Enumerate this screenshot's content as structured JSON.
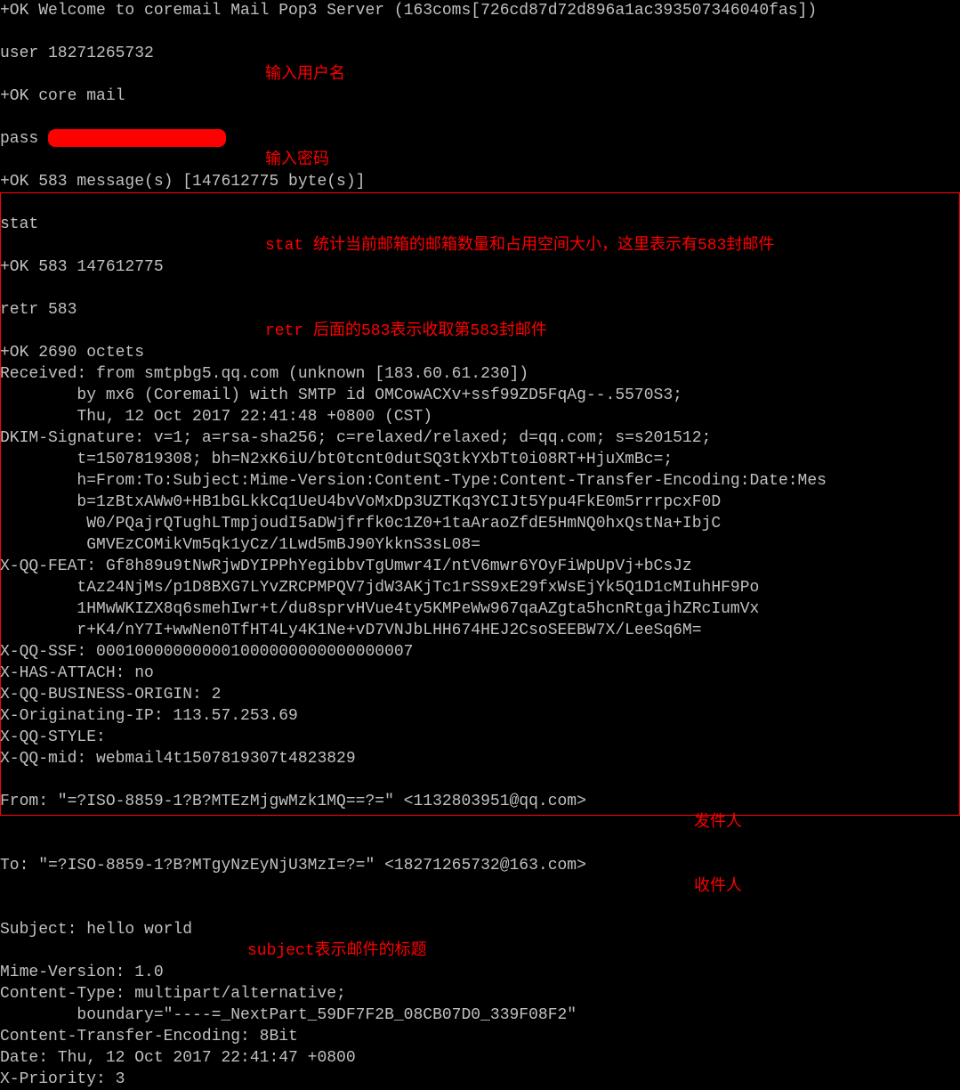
{
  "session": {
    "welcome": "+OK Welcome to coremail Mail Pop3 Server (163coms[726cd87d72d896a1ac393507346040fas])",
    "user_cmd": "user 18271265732",
    "user_annotation": "输入用户名",
    "user_response": "+OK core mail",
    "pass_cmd": "pass ",
    "pass_annotation": "输入密码",
    "msg_count": "+OK 583 message(s) [147612775 byte(s)]",
    "stat_cmd": "stat",
    "stat_annotation": "stat 统计当前邮箱的邮箱数量和占用空间大小，这里表示有583封邮件",
    "stat_response": "+OK 583 147612775",
    "retr_cmd": "retr 583",
    "retr_annotation": "retr 后面的583表示收取第583封邮件",
    "retr_response": "+OK 2690 octets"
  },
  "headers": {
    "received1": "Received: from smtpbg5.qq.com (unknown [183.60.61.230])",
    "received2": "        by mx6 (Coremail) with SMTP id OMCowACXv+ssf99ZD5FqAg--.5570S3;",
    "received3": "        Thu, 12 Oct 2017 22:41:48 +0800 (CST)",
    "dkim1": "DKIM-Signature: v=1; a=rsa-sha256; c=relaxed/relaxed; d=qq.com; s=s201512;",
    "dkim2": "        t=1507819308; bh=N2xK6iU/bt0tcnt0dutSQ3tkYXbTt0i08RT+HjuXmBc=;",
    "dkim3": "        h=From:To:Subject:Mime-Version:Content-Type:Content-Transfer-Encoding:Date:Mes",
    "dkim4": "        b=1zBtxAWw0+HB1bGLkkCq1UeU4bvVoMxDp3UZTKq3YCIJt5Ypu4FkE0m5rrrpcxF0D",
    "dkim5": "         W0/PQajrQTughLTmpjoudI5aDWjfrfk0c1Z0+1taAraoZfdE5HmNQ0hxQstNa+IbjC",
    "dkim6": "         GMVEzCOMikVm5qk1yCz/1Lwd5mBJ90YkknS3sL08=",
    "xqqfeat1": "X-QQ-FEAT: Gf8h89u9tNwRjwDYIPPhYegibbvTgUmwr4I/ntV6mwr6YOyFiWpUpVj+bCsJz",
    "xqqfeat2": "        tAz24NjMs/p1D8BXG7LYvZRCPMPQV7jdW3AKjTc1rSS9xE29fxWsEjYk5Q1D1cMIuhHF9Po",
    "xqqfeat3": "        1HMwWKIZX8q6smehIwr+t/du8sprvHVue4ty5KMPeWw967qaAZgta5hcnRtgajhZRcIumVx",
    "xqqfeat4": "        r+K4/nY7I+wwNen0TfHT4Ly4K1Ne+vD7VNJbLHH674HEJ2CsoSEEBW7X/LeeSq6M=",
    "xqqssf": "X-QQ-SSF: 000100000000001000000000000000007",
    "xhasattach": "X-HAS-ATTACH: no",
    "xqqbusiness": "X-QQ-BUSINESS-ORIGIN: 2",
    "xoriginip": "X-Originating-IP: 113.57.253.69",
    "xqqstyle": "X-QQ-STYLE:",
    "xqqmid": "X-QQ-mid: webmail4t1507819307t4823829",
    "from": "From: \"=?ISO-8859-1?B?MTEzMjgwMzk1MQ==?=\" <1132803951@qq.com>",
    "from_annotation": "发件人",
    "to": "To: \"=?ISO-8859-1?B?MTgyNzEyNjU3MzI=?=\" <18271265732@163.com>",
    "to_annotation": "收件人",
    "subject": "Subject: hello world",
    "subject_annotation": "subject表示邮件的标题",
    "mime": "Mime-Version: 1.0",
    "contenttype": "Content-Type: multipart/alternative;",
    "boundary": "        boundary=\"----=_NextPart_59DF7F2B_08CB07D0_339F08F2\"",
    "cte": "Content-Transfer-Encoding: 8Bit",
    "date": "Date: Thu, 12 Oct 2017 22:41:47 +0800",
    "xpriority": "X-Priority: 3"
  }
}
